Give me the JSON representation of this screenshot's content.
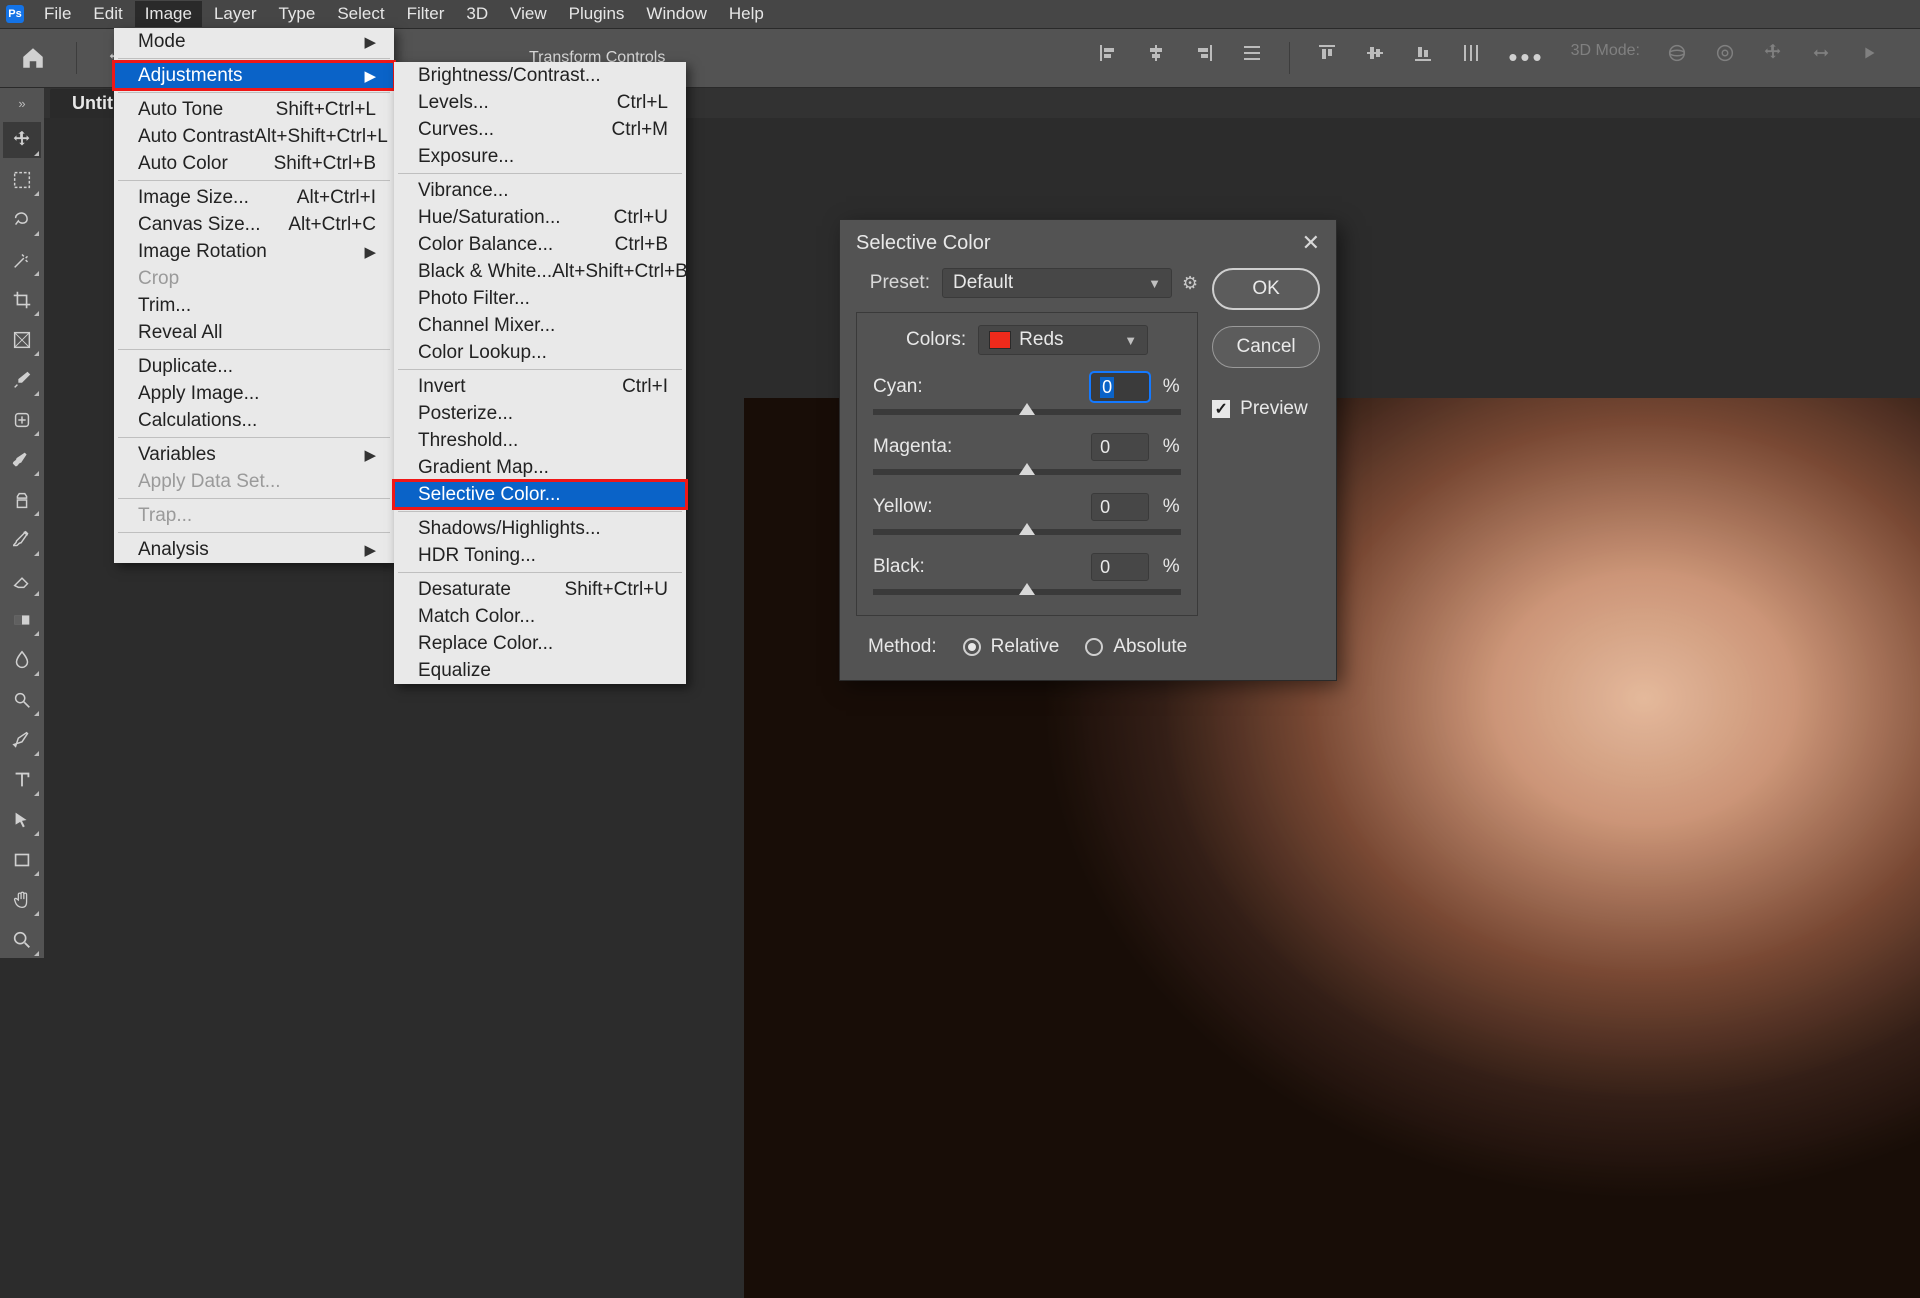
{
  "app_icon": "Ps",
  "menubar": [
    "File",
    "Edit",
    "Image",
    "Layer",
    "Type",
    "Select",
    "Filter",
    "3D",
    "View",
    "Plugins",
    "Window",
    "Help"
  ],
  "menubar_open_index": 2,
  "optionsbar": {
    "transform_label": "Transform Controls",
    "mode_label": "3D Mode:"
  },
  "doctab": "Untitled",
  "menu_image": {
    "groups": [
      [
        {
          "label": "Mode",
          "submenu": true
        }
      ],
      [
        {
          "label": "Adjustments",
          "submenu": true,
          "highlight": true,
          "redbox": true
        }
      ],
      [
        {
          "label": "Auto Tone",
          "short": "Shift+Ctrl+L"
        },
        {
          "label": "Auto Contrast",
          "short": "Alt+Shift+Ctrl+L"
        },
        {
          "label": "Auto Color",
          "short": "Shift+Ctrl+B"
        }
      ],
      [
        {
          "label": "Image Size...",
          "short": "Alt+Ctrl+I"
        },
        {
          "label": "Canvas Size...",
          "short": "Alt+Ctrl+C"
        },
        {
          "label": "Image Rotation",
          "submenu": true
        },
        {
          "label": "Crop",
          "disabled": true
        },
        {
          "label": "Trim..."
        },
        {
          "label": "Reveal All"
        }
      ],
      [
        {
          "label": "Duplicate..."
        },
        {
          "label": "Apply Image..."
        },
        {
          "label": "Calculations..."
        }
      ],
      [
        {
          "label": "Variables",
          "submenu": true
        },
        {
          "label": "Apply Data Set...",
          "disabled": true
        }
      ],
      [
        {
          "label": "Trap...",
          "disabled": true
        }
      ],
      [
        {
          "label": "Analysis",
          "submenu": true
        }
      ]
    ]
  },
  "menu_adjust": {
    "groups": [
      [
        {
          "label": "Brightness/Contrast..."
        },
        {
          "label": "Levels...",
          "short": "Ctrl+L"
        },
        {
          "label": "Curves...",
          "short": "Ctrl+M"
        },
        {
          "label": "Exposure..."
        }
      ],
      [
        {
          "label": "Vibrance..."
        },
        {
          "label": "Hue/Saturation...",
          "short": "Ctrl+U"
        },
        {
          "label": "Color Balance...",
          "short": "Ctrl+B"
        },
        {
          "label": "Black & White...",
          "short": "Alt+Shift+Ctrl+B"
        },
        {
          "label": "Photo Filter..."
        },
        {
          "label": "Channel Mixer..."
        },
        {
          "label": "Color Lookup..."
        }
      ],
      [
        {
          "label": "Invert",
          "short": "Ctrl+I"
        },
        {
          "label": "Posterize..."
        },
        {
          "label": "Threshold..."
        },
        {
          "label": "Gradient Map..."
        },
        {
          "label": "Selective Color...",
          "highlight": true,
          "redbox": true
        }
      ],
      [
        {
          "label": "Shadows/Highlights..."
        },
        {
          "label": "HDR Toning..."
        }
      ],
      [
        {
          "label": "Desaturate",
          "short": "Shift+Ctrl+U"
        },
        {
          "label": "Match Color..."
        },
        {
          "label": "Replace Color..."
        },
        {
          "label": "Equalize"
        }
      ]
    ]
  },
  "dialog": {
    "title": "Selective Color",
    "preset_label": "Preset:",
    "preset_value": "Default",
    "colors_label": "Colors:",
    "colors_value": "Reds",
    "swatch": "#ef2a1b",
    "sliders": [
      {
        "label": "Cyan:",
        "value": "0",
        "active": true
      },
      {
        "label": "Magenta:",
        "value": "0"
      },
      {
        "label": "Yellow:",
        "value": "0"
      },
      {
        "label": "Black:",
        "value": "0"
      }
    ],
    "percent": "%",
    "method_label": "Method:",
    "method_relative": "Relative",
    "method_absolute": "Absolute",
    "ok": "OK",
    "cancel": "Cancel",
    "preview": "Preview"
  },
  "tools": [
    "move",
    "marquee",
    "lasso",
    "wand",
    "crop",
    "frame",
    "eyedropper",
    "heal",
    "brush",
    "clone",
    "history-brush",
    "eraser",
    "gradient",
    "blur",
    "dodge",
    "pen",
    "type",
    "path-select",
    "rectangle",
    "hand",
    "zoom"
  ]
}
